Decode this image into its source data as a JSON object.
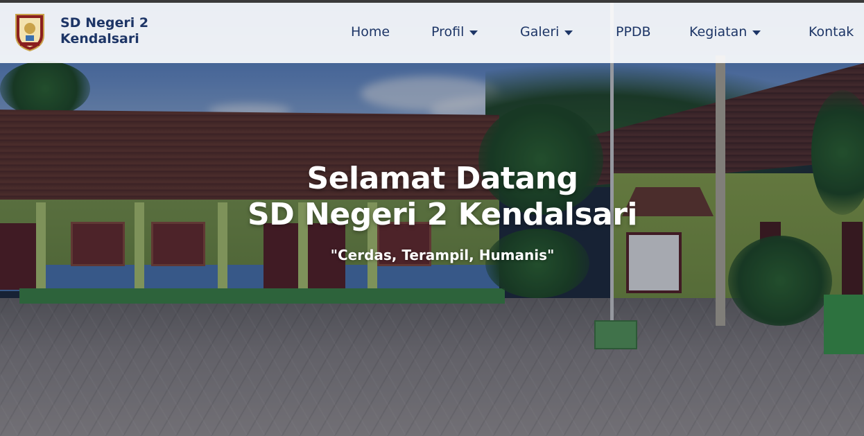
{
  "header": {
    "brand_line1": "SD Negeri 2",
    "brand_line2": "Kendalsari",
    "logo_icon": "school-crest-icon"
  },
  "nav": {
    "items": [
      {
        "label": "Home",
        "dropdown": false
      },
      {
        "label": "Profil",
        "dropdown": true
      },
      {
        "label": "Galeri",
        "dropdown": true
      },
      {
        "label": "PPDB",
        "dropdown": false
      },
      {
        "label": "Kegiatan",
        "dropdown": true
      },
      {
        "label": "Kontak",
        "dropdown": false
      }
    ]
  },
  "hero": {
    "title_line1": "Selamat Datang",
    "title_line2": "SD Negeri 2 Kendalsari",
    "tagline": "\"Cerdas, Terampil, Humanis\""
  },
  "colors": {
    "brand": "#1d3566",
    "header_bg": "#ffffff",
    "hero_text": "#ffffff"
  }
}
